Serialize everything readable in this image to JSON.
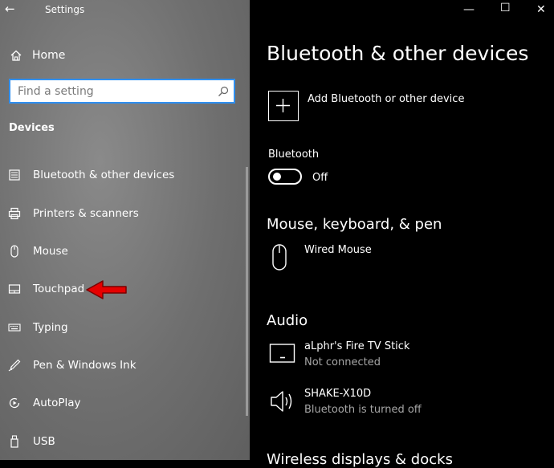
{
  "window": {
    "title": "Settings",
    "back": "←",
    "minimize": "—",
    "maximize": "☐",
    "close": "✕"
  },
  "sidebar": {
    "home_label": "Home",
    "search_placeholder": "Find a setting",
    "section_title": "Devices",
    "items": [
      {
        "label": "Bluetooth & other devices",
        "icon": "bluetooth-devices-icon"
      },
      {
        "label": "Printers & scanners",
        "icon": "printer-icon"
      },
      {
        "label": "Mouse",
        "icon": "mouse-icon"
      },
      {
        "label": "Touchpad",
        "icon": "touchpad-icon"
      },
      {
        "label": "Typing",
        "icon": "keyboard-icon"
      },
      {
        "label": "Pen & Windows Ink",
        "icon": "pen-icon"
      },
      {
        "label": "AutoPlay",
        "icon": "autoplay-icon"
      },
      {
        "label": "USB",
        "icon": "usb-icon"
      }
    ]
  },
  "main": {
    "title": "Bluetooth & other devices",
    "add_device_label": "Add Bluetooth or other device",
    "bluetooth_label": "Bluetooth",
    "bluetooth_state": "Off",
    "mouse_section": {
      "title": "Mouse, keyboard, & pen",
      "devices": [
        {
          "name": "Wired Mouse"
        }
      ]
    },
    "audio_section": {
      "title": "Audio",
      "devices": [
        {
          "name": "aLphr's Fire TV Stick",
          "status": "Not connected"
        },
        {
          "name": "SHAKE-X10D",
          "status": "Bluetooth is turned off"
        }
      ]
    },
    "next_section_title_partial": "Wireless displays & docks"
  },
  "colors": {
    "accent": "#2f8ff0",
    "annotation_arrow": "#e60000",
    "status_text": "#a6a6a6"
  }
}
